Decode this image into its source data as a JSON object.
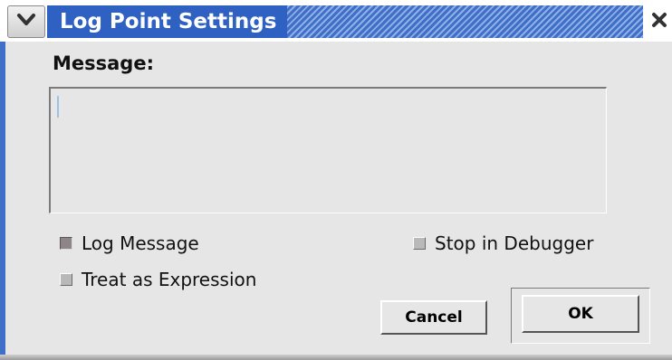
{
  "window": {
    "title": "Log Point Settings"
  },
  "titlebar": {
    "menu_icon": "chevron-down-icon",
    "close_icon": "close-icon"
  },
  "form": {
    "message_label": "Message:",
    "message_value": "",
    "log_message": {
      "label": "Log Message",
      "checked": true
    },
    "stop_in_debugger": {
      "label": "Stop in Debugger",
      "checked": false
    },
    "treat_as_expression": {
      "label": "Treat as Expression",
      "checked": false
    }
  },
  "buttons": {
    "cancel": "Cancel",
    "ok": "OK"
  },
  "colors": {
    "title_bar": "#2f61c3",
    "window_bg": "#e6e6e6"
  }
}
